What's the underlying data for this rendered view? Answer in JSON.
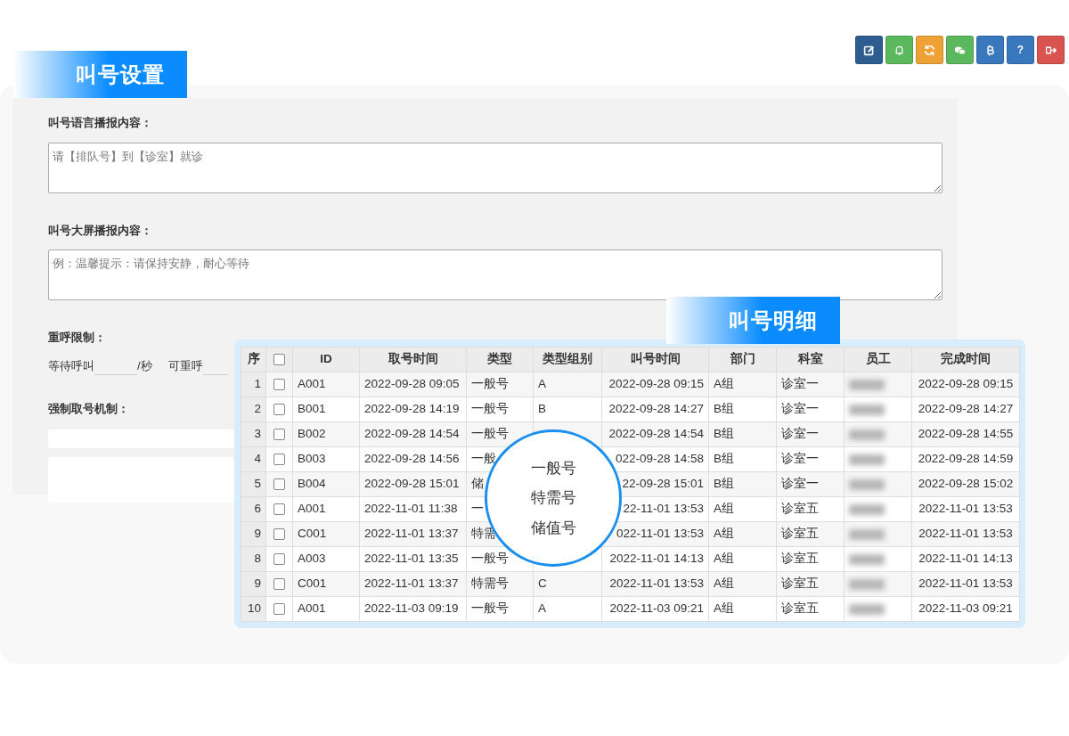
{
  "toolbar": [
    {
      "kind": "edit",
      "color": "#2e5e91"
    },
    {
      "kind": "bell",
      "color": "#5cb85c"
    },
    {
      "kind": "refresh",
      "color": "#eea236"
    },
    {
      "kind": "chat",
      "color": "#5cb85c"
    },
    {
      "kind": "bitcoin",
      "color": "#3a78bd"
    },
    {
      "kind": "help",
      "color": "#3a78bd",
      "label": "?"
    },
    {
      "kind": "logout",
      "color": "#d9534f"
    }
  ],
  "settings": {
    "title": "叫号设置",
    "fields": [
      {
        "label": "叫号语言播报内容：",
        "placeholder": "请【排队号】到【诊室】就诊"
      },
      {
        "label": "叫号大屏播报内容：",
        "placeholder": "例：温馨提示：请保持安静，耐心等待"
      }
    ],
    "recall": {
      "label": "重呼限制：",
      "wait_label": "等待呼叫",
      "unit": "/秒",
      "recall_label": "可重呼"
    },
    "force": {
      "label": "强制取号机制："
    }
  },
  "details": {
    "title": "叫号明细",
    "columns": [
      "序",
      "ID",
      "取号时间",
      "类型",
      "类型组别",
      "叫号时间",
      "部门",
      "科室",
      "员工",
      "完成时间"
    ],
    "header_checked": false,
    "rows": [
      {
        "seq": "1",
        "checked": false,
        "id": "A001",
        "take_time": "2022-09-28 09:05",
        "type": "一般号",
        "group": "A",
        "call_time": "2022-09-28 09:15",
        "dept": "A组",
        "room": "诊室一",
        "done_time": "2022-09-28 09:15"
      },
      {
        "seq": "2",
        "checked": false,
        "id": "B001",
        "take_time": "2022-09-28 14:19",
        "type": "一般号",
        "group": "B",
        "call_time": "2022-09-28 14:27",
        "dept": "B组",
        "room": "诊室一",
        "done_time": "2022-09-28 14:27"
      },
      {
        "seq": "3",
        "checked": false,
        "id": "B002",
        "take_time": "2022-09-28 14:54",
        "type": "一般号",
        "call_time": "2022-09-28 14:54",
        "dept": "B组",
        "room": "诊室一",
        "done_time": "2022-09-28 14:55"
      },
      {
        "seq": "4",
        "checked": false,
        "id": "B003",
        "take_time": "2022-09-28 14:56",
        "type": "一般",
        "call_time": "022-09-28 14:58",
        "dept": "B组",
        "room": "诊室一",
        "done_time": "2022-09-28 14:59"
      },
      {
        "seq": "5",
        "checked": false,
        "id": "B004",
        "take_time": "2022-09-28 15:01",
        "type": "储",
        "call_time": "22-09-28 15:01",
        "dept": "B组",
        "room": "诊室一",
        "done_time": "2022-09-28 15:02"
      },
      {
        "seq": "6",
        "checked": false,
        "id": "A001",
        "take_time": "2022-11-01 11:38",
        "type": "一",
        "call_time": "22-11-01 13:53",
        "dept": "A组",
        "room": "诊室五",
        "done_time": "2022-11-01 13:53"
      },
      {
        "seq": "9",
        "checked": false,
        "id": "C001",
        "take_time": "2022-11-01 13:37",
        "type": "特需",
        "call_time": "022-11-01 13:53",
        "dept": "A组",
        "room": "诊室五",
        "done_time": "2022-11-01 13:53"
      },
      {
        "seq": "8",
        "checked": false,
        "id": "A003",
        "take_time": "2022-11-01 13:35",
        "type": "一般号",
        "call_time": "2022-11-01 14:13",
        "dept": "A组",
        "room": "诊室五",
        "done_time": "2022-11-01 14:13"
      },
      {
        "seq": "9",
        "checked": false,
        "id": "C001",
        "take_time": "2022-11-01 13:37",
        "type": "特需号",
        "group": "C",
        "call_time": "2022-11-01 13:53",
        "dept": "A组",
        "room": "诊室五",
        "done_time": "2022-11-01 13:53"
      },
      {
        "seq": "10",
        "checked": false,
        "id": "A001",
        "take_time": "2022-11-03 09:19",
        "type": "一般号",
        "group": "A",
        "call_time": "2022-11-03 09:21",
        "dept": "A组",
        "room": "诊室五",
        "done_time": "2022-11-03 09:21"
      }
    ],
    "type_options": [
      "一般号",
      "特需号",
      "储值号"
    ]
  }
}
